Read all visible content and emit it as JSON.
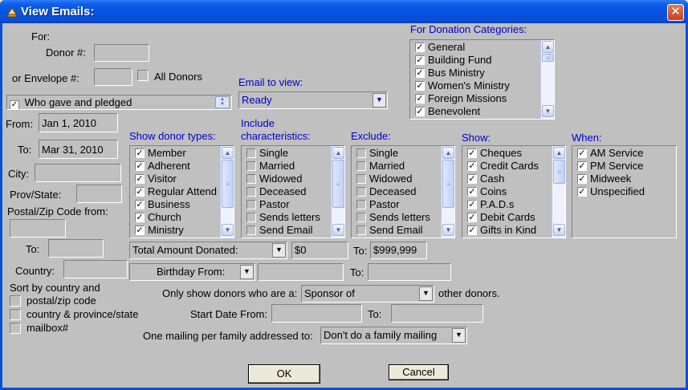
{
  "window": {
    "title": "View Emails:",
    "close_glyph": "✕"
  },
  "labels": {
    "for": "For:",
    "donor_num": "Donor #:",
    "or_envelope": "or Envelope #:",
    "all_donors": "All Donors",
    "email_to_view": "Email to view:",
    "for_donation_categories": "For Donation Categories:",
    "from": "From:",
    "to": "To:",
    "city": "City:",
    "prov_state": "Prov/State:",
    "postal_from": "Postal/Zip Code from:",
    "postal_to": "To:",
    "country": "Country:",
    "sort_by": "Sort by country and",
    "show_donor_types": "Show donor types:",
    "include_characteristics_1": "Include",
    "include_characteristics_2": "characteristics:",
    "exclude": "Exclude:",
    "show": "Show:",
    "when": "When:",
    "amount_to": "To:",
    "birthday_to": "To:",
    "only_show": "Only show donors who are a:",
    "other_donors": "other donors.",
    "start_date_from": "Start Date From:",
    "start_date_to": "To:",
    "one_mailing": "One mailing per family addressed to:"
  },
  "fields": {
    "donor_num": "",
    "envelope_num": "",
    "gave_pledged": "Who gave and pledged",
    "email_to_view": "Ready",
    "from_date": "Jan 1, 2010",
    "to_date": "Mar 31, 2010",
    "city": "",
    "prov_state": "",
    "postal_from": "",
    "postal_to": "",
    "country": "",
    "amount_combo": "Total Amount Donated:",
    "amount_from": "$0",
    "amount_to": "$999,999",
    "birthday_combo": "Birthday From:",
    "birthday_from": "",
    "birthday_to": "",
    "sponsor_combo": "Sponsor of",
    "start_date_from": "",
    "start_date_to": "",
    "family_mailing": "Don't do a family mailing"
  },
  "donation_categories": [
    {
      "label": "General",
      "checked": true
    },
    {
      "label": "Building Fund",
      "checked": true
    },
    {
      "label": "Bus Ministry",
      "checked": true
    },
    {
      "label": "Women's Ministry",
      "checked": true
    },
    {
      "label": "Foreign Missions",
      "checked": true
    },
    {
      "label": "Benevolent",
      "checked": true
    }
  ],
  "donor_types": [
    {
      "label": "Member",
      "checked": true
    },
    {
      "label": "Adherent",
      "checked": true
    },
    {
      "label": "Visitor",
      "checked": true
    },
    {
      "label": "Regular Attend",
      "checked": true
    },
    {
      "label": "Business",
      "checked": true
    },
    {
      "label": "Church",
      "checked": true
    },
    {
      "label": "Ministry",
      "checked": true
    }
  ],
  "include_characteristics": [
    {
      "label": "Single",
      "checked": false
    },
    {
      "label": "Married",
      "checked": false
    },
    {
      "label": "Widowed",
      "checked": false
    },
    {
      "label": "Deceased",
      "checked": false
    },
    {
      "label": "Pastor",
      "checked": false
    },
    {
      "label": "Sends letters",
      "checked": false
    },
    {
      "label": "Send Email",
      "checked": false
    }
  ],
  "exclude": [
    {
      "label": "Single",
      "checked": false
    },
    {
      "label": "Married",
      "checked": false
    },
    {
      "label": "Widowed",
      "checked": false
    },
    {
      "label": "Deceased",
      "checked": false
    },
    {
      "label": "Pastor",
      "checked": false
    },
    {
      "label": "Sends letters",
      "checked": false
    },
    {
      "label": "Send Email",
      "checked": false
    }
  ],
  "show_types": [
    {
      "label": "Cheques",
      "checked": true
    },
    {
      "label": "Credit Cards",
      "checked": true
    },
    {
      "label": "Cash",
      "checked": true
    },
    {
      "label": "Coins",
      "checked": true
    },
    {
      "label": "P.A.D.s",
      "checked": true
    },
    {
      "label": "Debit Cards",
      "checked": true
    },
    {
      "label": "Gifts in Kind",
      "checked": true
    }
  ],
  "when": [
    {
      "label": "AM Service",
      "checked": true
    },
    {
      "label": "PM Service",
      "checked": true
    },
    {
      "label": "Midweek",
      "checked": true
    },
    {
      "label": "Unspecified",
      "checked": true
    }
  ],
  "sort_options": [
    {
      "label": "postal/zip code",
      "checked": false
    },
    {
      "label": "country & province/state",
      "checked": false
    },
    {
      "label": "mailbox#",
      "checked": false
    }
  ],
  "buttons": {
    "ok": "OK",
    "cancel": "Cancel"
  }
}
